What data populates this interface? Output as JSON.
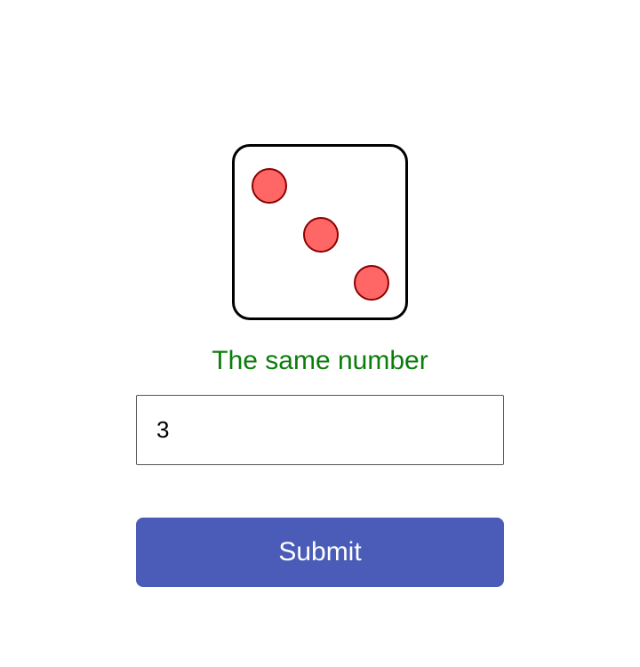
{
  "die": {
    "value": 3,
    "pip_fill": "#ff6666",
    "pip_border": "#8b0000"
  },
  "feedback": {
    "text": "The same number",
    "color": "#0a7d0a"
  },
  "answer": {
    "value": "3"
  },
  "submit": {
    "label": "Submit",
    "color": "#4a5bb8"
  }
}
